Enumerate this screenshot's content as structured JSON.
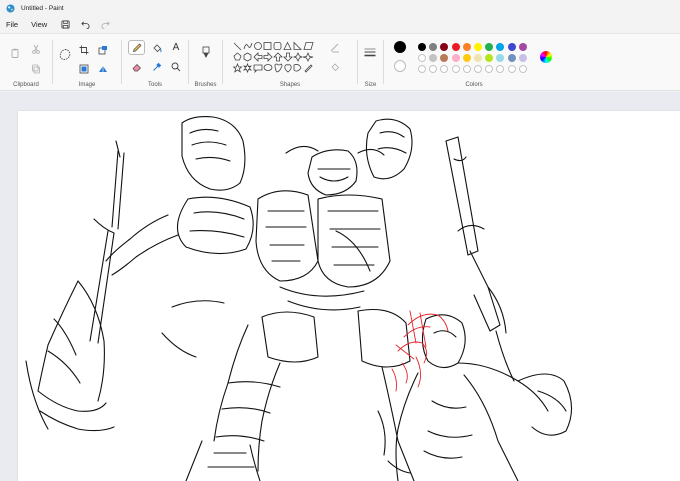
{
  "window": {
    "title": "Untitled - Paint"
  },
  "menu": {
    "file": "File",
    "view": "View"
  },
  "ribbon": {
    "groups": {
      "clipboard": "Clipboard",
      "image": "Image",
      "tools": "Tools",
      "brushes": "Brushes",
      "shapes": "Shapes",
      "size": "Size",
      "colors": "Colors"
    },
    "text_tool_glyph": "A"
  },
  "colors": {
    "primary": "#000000",
    "secondary": "#ffffff",
    "palette_row1": [
      "#000000",
      "#7f7f7f",
      "#880015",
      "#ed1c24",
      "#ff7f27",
      "#fff200",
      "#22b14c",
      "#00a2e8",
      "#3f48cc",
      "#a349a4"
    ],
    "palette_row2": [
      "#ffffff",
      "#c3c3c3",
      "#b97a57",
      "#ffaec9",
      "#ffc90e",
      "#efe4b0",
      "#b5e61d",
      "#99d9ea",
      "#7092be",
      "#c8bfe7"
    ]
  }
}
